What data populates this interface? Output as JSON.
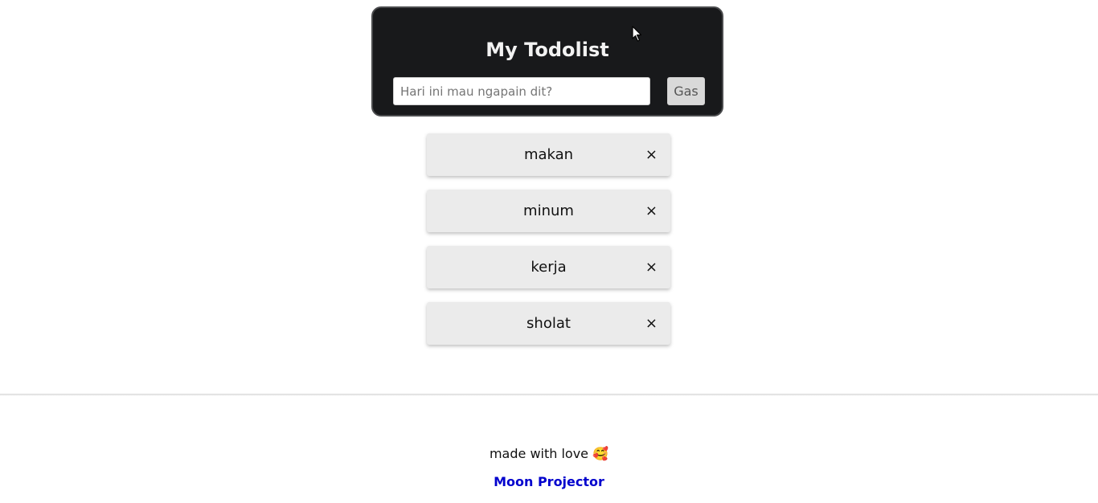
{
  "app": {
    "title": "My Todolist"
  },
  "form": {
    "placeholder": "Hari ini mau ngapain dit?",
    "value": "",
    "submit_label": "Gas"
  },
  "todos": [
    {
      "text": "makan",
      "delete_label": "×"
    },
    {
      "text": "minum",
      "delete_label": "×"
    },
    {
      "text": "kerja",
      "delete_label": "×"
    },
    {
      "text": "sholat",
      "delete_label": "×"
    }
  ],
  "footer": {
    "text": "made with love 🥰",
    "link_label": "Moon Projector"
  },
  "colors": {
    "header_bg": "#18191b",
    "item_bg": "#ebebeb",
    "link": "#0000cd"
  }
}
